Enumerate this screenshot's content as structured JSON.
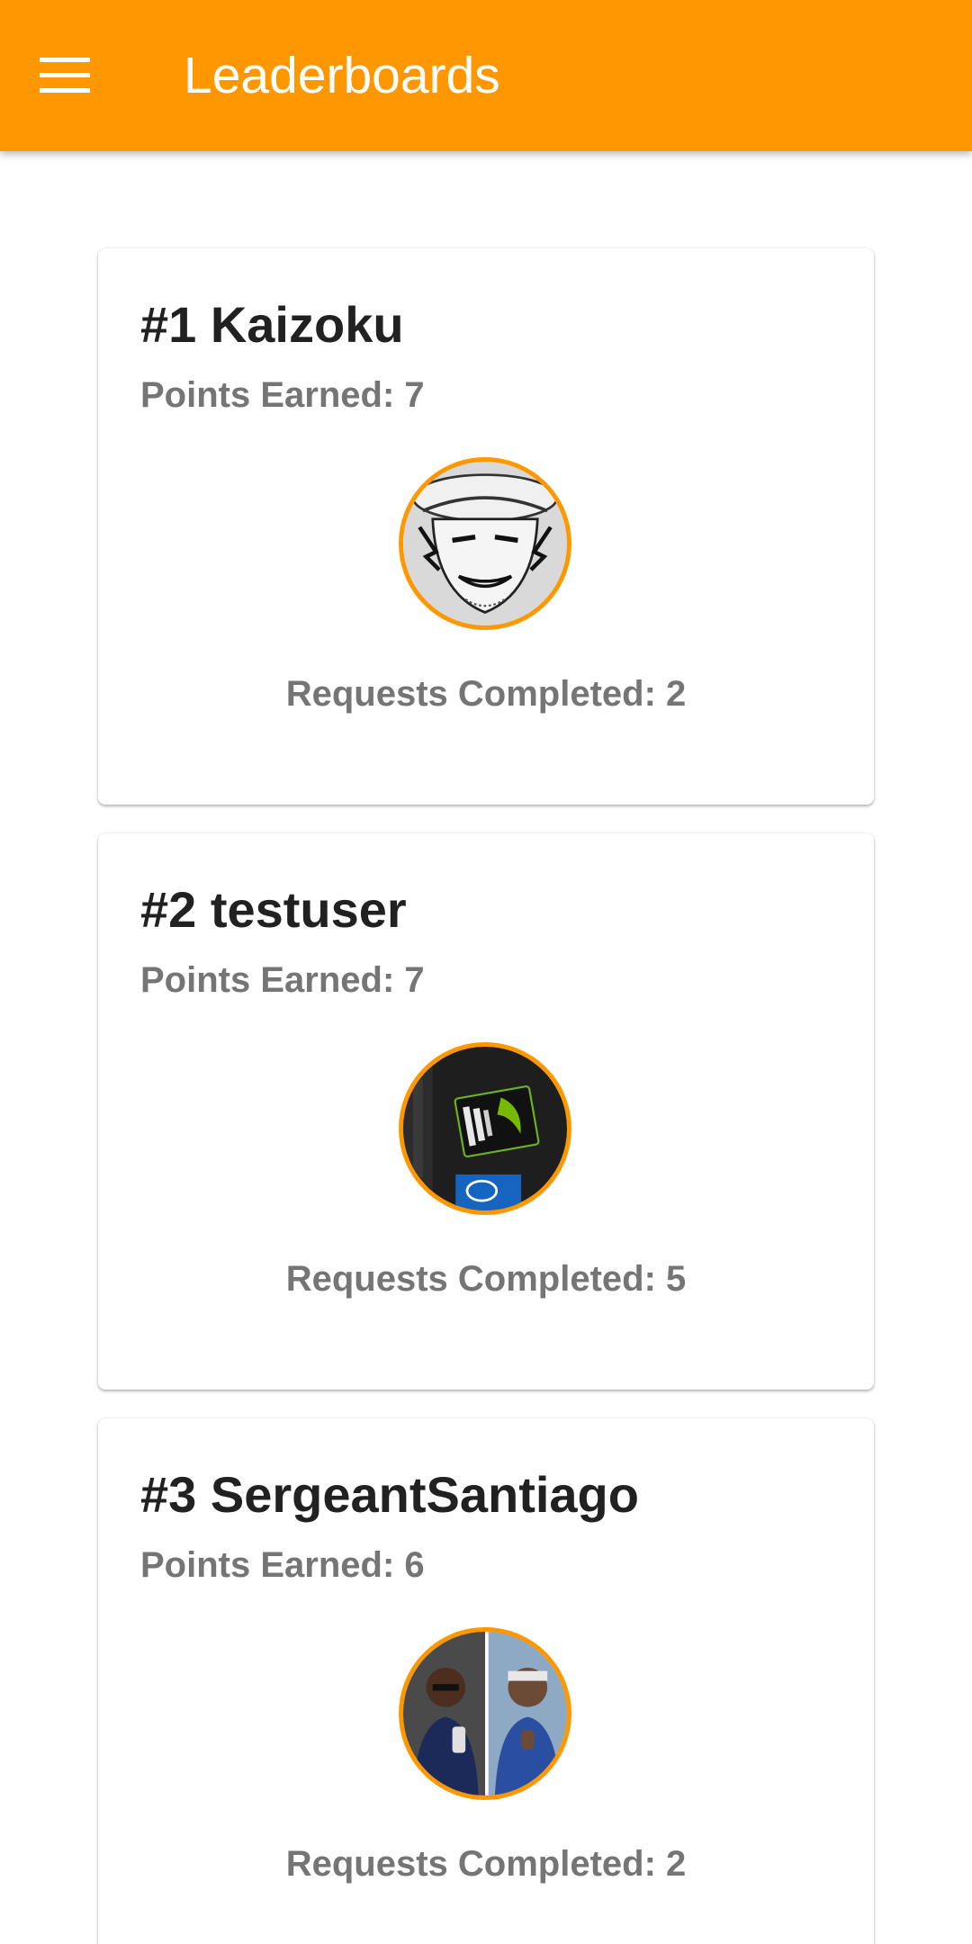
{
  "app_bar": {
    "title": "Leaderboards",
    "menu_icon": "menu-icon",
    "color": "#FF9800"
  },
  "leaderboard": [
    {
      "name": "#1 Kaizoku",
      "points": "Points Earned: 7",
      "requests": "Requests Completed: 2",
      "avatar_icon": "avatar-image"
    },
    {
      "name": "#2 testuser",
      "points": "Points Earned: 7",
      "requests": "Requests Completed: 5",
      "avatar_icon": "avatar-image"
    },
    {
      "name": "#3 SergeantSantiago",
      "points": "Points Earned: 6",
      "requests": "Requests Completed: 2",
      "avatar_icon": "avatar-image"
    }
  ],
  "colors": {
    "accent": "#FF9800",
    "title_text": "#212121",
    "secondary_text": "#757575"
  }
}
